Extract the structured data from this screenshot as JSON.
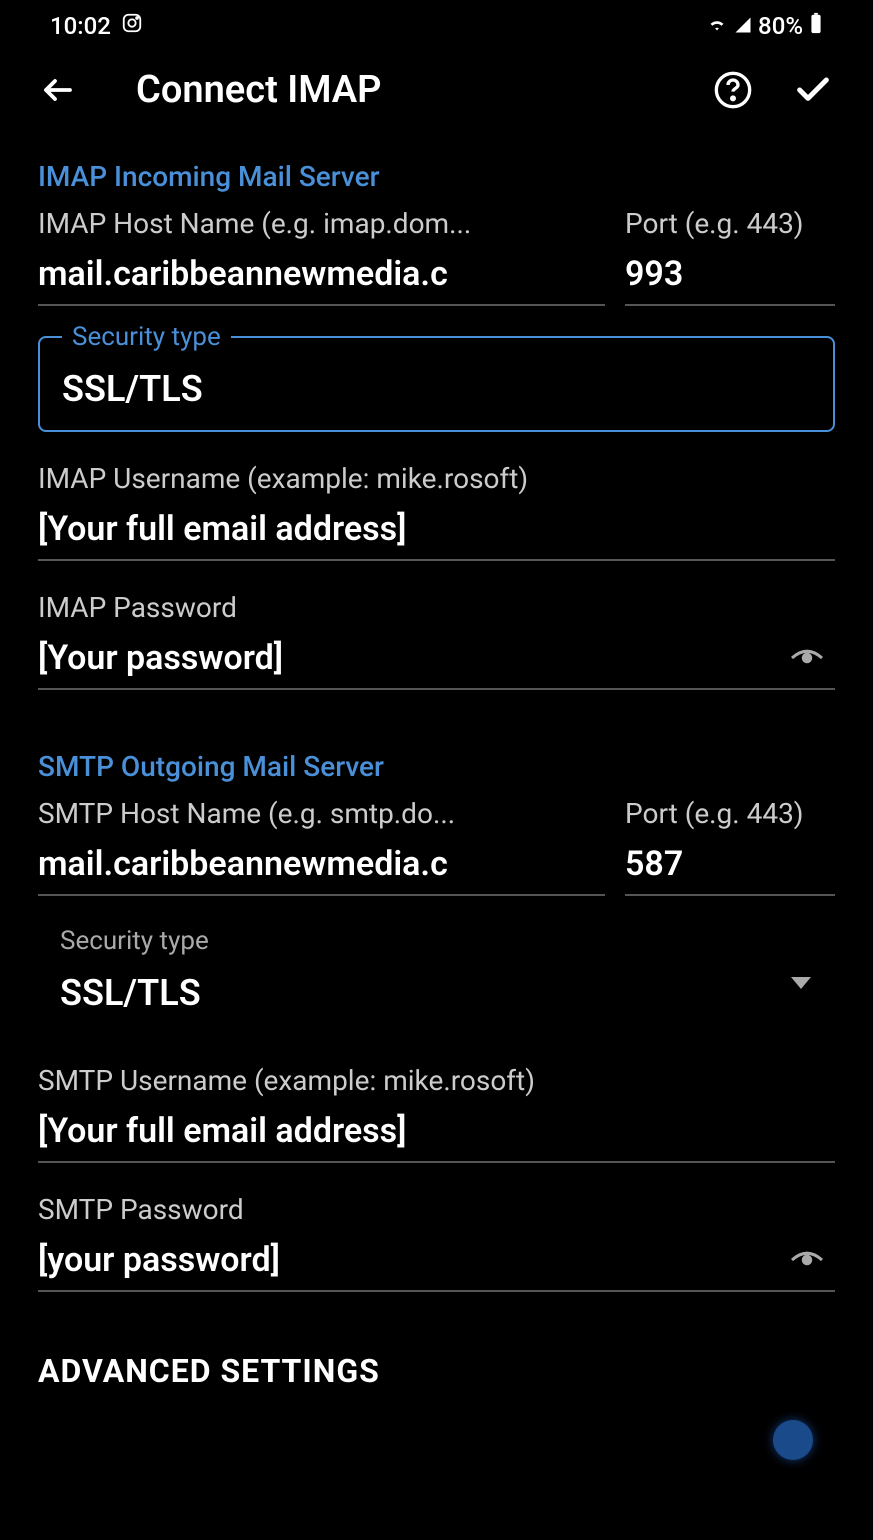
{
  "status": {
    "time": "10:02",
    "battery": "80%"
  },
  "header": {
    "title": "Connect IMAP"
  },
  "imap_section": {
    "header": "IMAP Incoming Mail Server",
    "host_label": "IMAP Host Name (e.g. imap.dom...",
    "host_value": "mail.caribbeannewmedia.c",
    "port_label": "Port (e.g. 443)",
    "port_value": "993",
    "security_label": "Security type",
    "security_value": "SSL/TLS",
    "username_label": "IMAP Username (example: mike.rosoft)",
    "username_value": "[Your full email address]",
    "password_label": "IMAP Password",
    "password_value": "[Your password]"
  },
  "smtp_section": {
    "header": "SMTP Outgoing Mail Server",
    "host_label": "SMTP Host Name (e.g. smtp.do...",
    "host_value": "mail.caribbeannewmedia.c",
    "port_label": "Port (e.g. 443)",
    "port_value": "587",
    "security_label": "Security type",
    "security_value": "SSL/TLS",
    "username_label": "SMTP Username (example: mike.rosoft)",
    "username_value": "[Your full email address]",
    "password_label": "SMTP Password",
    "password_value": "[your password]"
  },
  "advanced": {
    "label": "ADVANCED SETTINGS"
  }
}
